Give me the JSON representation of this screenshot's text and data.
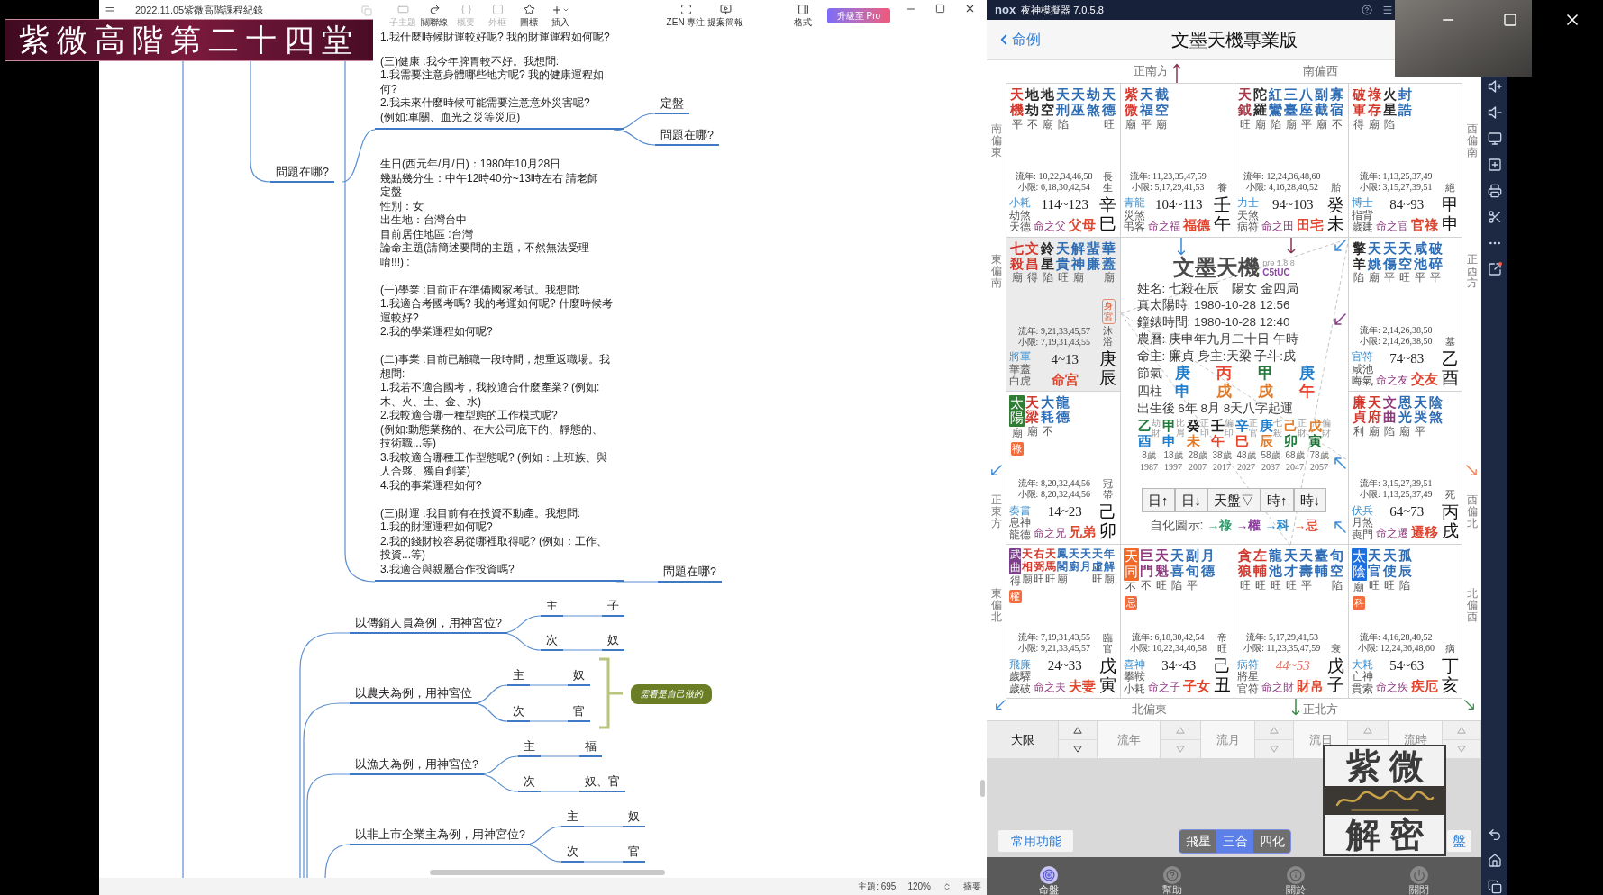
{
  "banner": "紫微高階第二十四堂",
  "mindmap": {
    "doc_title": "2022.11.05紫微高階課程紀錄",
    "toolbar": [
      {
        "label": "子主題",
        "disabled": true
      },
      {
        "label": "關聯線",
        "disabled": false
      },
      {
        "label": "概要",
        "disabled": true
      },
      {
        "label": "外框",
        "disabled": true
      },
      {
        "label": "圖標",
        "disabled": false
      },
      {
        "label": "插入",
        "disabled": false
      }
    ],
    "view_tools": [
      "ZEN 專注",
      "提案簡報",
      "格式"
    ],
    "upgrade": "升級至 Pro",
    "topic": "問題在哪?",
    "detail_blocks": [
      {
        "groups": [
          [
            "1.我什麼時候財運較好呢? 我的財運運程如何呢?"
          ],
          [
            "(三)健康 :我今年脾胃較不好。我想問:",
            "1.我需要注意身體哪些地方呢? 我的健康運程如何?",
            "2.我未來什麼時候可能需要注意意外災害呢? (例如:車關、血光之災等災厄)"
          ]
        ],
        "branches": [
          "定盤",
          "問題在哪?"
        ]
      },
      {
        "groups": [
          [
            "生日(西元年/月/日)：1980年10月28日",
            "幾點幾分生：中午12時40分~13時左右 請老師定盤",
            "性別：女",
            "出生地：台灣台中",
            "目前居住地區 :台灣",
            "論命主題(請簡述要問的主題，不然無法受理唷!!!) :"
          ],
          [
            "(一)學業 :目前正在準備國家考試。我想問:",
            "1.我適合考國考嗎? 我的考運如何呢? 什麼時候考運較好?",
            "2.我的學業運程如何呢?"
          ],
          [
            "(二)事業 :目前已離職一段時間，想重返職場。我想問:",
            "1.我若不適合國考，我較適合什麼產業? (例如:木、火、土、金、水)",
            "2.我較適合哪一種型態的工作模式呢?",
            "(例如:動態業務的、在大公司底下的、靜態的、技術職...等)",
            "3.我較適合哪種工作型態呢? (例如：上班族、與人合夥、獨自創業)",
            "4.我的事業運程如何?"
          ],
          [
            "(三)財運 :我目前有在投資不動產。我想問:",
            "1.我的財運運程如何呢?",
            "2.我的錢財較容易從哪裡取得呢? (例如：工作、投資...等)",
            "3.我適合與親屬合作投資嗎?"
          ]
        ],
        "branches": [
          "問題在哪?"
        ]
      }
    ],
    "examples": [
      {
        "title": "以傳銷人員為例，用神宮位?",
        "rows": [
          {
            "rank": "主",
            "palace": "子"
          },
          {
            "rank": "次",
            "palace": "奴"
          }
        ]
      },
      {
        "title": "以農夫為例，用神宮位",
        "rows": [
          {
            "rank": "主",
            "palace": "奴"
          },
          {
            "rank": "次",
            "palace": "官"
          }
        ],
        "note": "需看是自己做的"
      },
      {
        "title": "以漁夫為例，用神宮位?",
        "rows": [
          {
            "rank": "主",
            "palace": "福"
          },
          {
            "rank": "次",
            "palace": "奴、官"
          }
        ]
      },
      {
        "title": "以非上市企業主為例，用神宮位?",
        "rows": [
          {
            "rank": "主",
            "palace": "奴"
          },
          {
            "rank": "次",
            "palace": "官"
          }
        ]
      }
    ],
    "status": {
      "topics": "主題: 695",
      "zoom": "120%",
      "summary": "摘要"
    }
  },
  "emulator": {
    "logo": "nox",
    "title": "夜神模擬器 7.0.5.8"
  },
  "app": {
    "back": "命例",
    "title": "文墨天機專業版",
    "directions": {
      "top": [
        "正南方",
        "南偏西"
      ],
      "bottom": [
        "北偏東",
        "正北方"
      ],
      "left": [
        "南偏東",
        "東偏南",
        "正東方",
        "東偏北"
      ],
      "right": [
        "西偏南",
        "正西方",
        "西偏北",
        "北偏西"
      ]
    },
    "palaces": [
      {
        "stars": [
          {
            "name": "天機",
            "kind": "plain",
            "color": "#d23a2f",
            "brightness": "平"
          },
          {
            "name": "地劫",
            "kind": "plain",
            "color": "#2a2a2a",
            "brightness": "不"
          },
          {
            "name": "地空",
            "kind": "plain",
            "color": "#2a2a2a",
            "brightness": "廟"
          },
          {
            "name": "天刑",
            "kind": "plain",
            "color": "#2f6db5",
            "brightness": "陷"
          },
          {
            "name": "天巫",
            "kind": "plain",
            "color": "#2f6db5"
          },
          {
            "name": "劫煞",
            "kind": "plain",
            "color": "#2f6db5"
          },
          {
            "name": "天德",
            "kind": "plain",
            "color": "#2f6db5",
            "brightness": "旺"
          }
        ],
        "years": "流年: 10,22,34,46,58",
        "minor_limit": "小限: 6,18,30,42,54",
        "stage": "長生",
        "range": "114~123",
        "current": false,
        "spirits": [
          "小耗",
          "劫煞",
          "天德"
        ],
        "owner": "命之父",
        "name": "父母",
        "stem_branch": "辛巳",
        "selected": false
      },
      {
        "stars": [
          {
            "name": "紫微",
            "kind": "plain",
            "color": "#d23a2f",
            "brightness": "廟"
          },
          {
            "name": "天福",
            "kind": "plain",
            "color": "#2f6db5",
            "brightness": "平"
          },
          {
            "name": "截空",
            "kind": "plain",
            "color": "#2f6db5",
            "brightness": "廟"
          }
        ],
        "years": "流年: 11,23,35,47,59",
        "minor_limit": "小限: 5,17,29,41,53",
        "stage": "養",
        "range": "104~113",
        "current": false,
        "spirits": [
          "青龍",
          "災煞",
          "弔客"
        ],
        "owner": "命之福",
        "name": "福德",
        "stem_branch": "壬午",
        "selected": false
      },
      {
        "stars": [
          {
            "name": "天鉞",
            "kind": "plain",
            "color": "#a83a4a",
            "brightness": "旺"
          },
          {
            "name": "陀羅",
            "kind": "plain",
            "color": "#2a2a2a",
            "brightness": "廟"
          },
          {
            "name": "紅鸞",
            "kind": "plain",
            "color": "#2f6db5",
            "brightness": "陷"
          },
          {
            "name": "三臺",
            "kind": "plain",
            "color": "#2f6db5",
            "brightness": "廟"
          },
          {
            "name": "八座",
            "kind": "plain",
            "color": "#2f6db5",
            "brightness": "平"
          },
          {
            "name": "副截",
            "kind": "plain",
            "color": "#2f6db5",
            "brightness": "廟"
          },
          {
            "name": "寡宿",
            "kind": "plain",
            "color": "#2f6db5",
            "brightness": "不"
          }
        ],
        "years": "流年: 12,24,36,48,60",
        "minor_limit": "小限: 4,16,28,40,52",
        "stage": "胎",
        "range": "94~103",
        "current": false,
        "spirits": [
          "力士",
          "天煞",
          "病符"
        ],
        "owner": "命之田",
        "name": "田宅",
        "stem_branch": "癸未",
        "selected": false
      },
      {
        "stars": [
          {
            "name": "破軍",
            "kind": "plain",
            "color": "#d23a2f",
            "brightness": "得"
          },
          {
            "name": "祿存",
            "kind": "plain",
            "color": "#d23a2f",
            "brightness": "廟"
          },
          {
            "name": "火星",
            "kind": "plain",
            "color": "#2a2a2a",
            "brightness": "陷"
          },
          {
            "name": "封誥",
            "kind": "plain",
            "color": "#2f6db5"
          }
        ],
        "years": "流年: 1,13,25,37,49",
        "minor_limit": "小限: 3,15,27,39,51",
        "stage": "絕",
        "range": "84~93",
        "current": false,
        "spirits": [
          "博士",
          "指背",
          "歲建"
        ],
        "owner": "命之官",
        "name": "官祿",
        "stem_branch": "甲申",
        "selected": false
      },
      {
        "stars": [
          {
            "name": "七殺",
            "kind": "plain",
            "color": "#d23a2f",
            "brightness": "廟"
          },
          {
            "name": "文昌",
            "kind": "plain",
            "color": "#d23a2f",
            "brightness": "得"
          },
          {
            "name": "鈴星",
            "kind": "plain",
            "color": "#2a2a2a",
            "brightness": "陷"
          },
          {
            "name": "天貴",
            "kind": "plain",
            "color": "#2f6db5",
            "brightness": "旺"
          },
          {
            "name": "解神",
            "kind": "plain",
            "color": "#2f6db5",
            "brightness": "廟"
          },
          {
            "name": "蜚廉",
            "kind": "plain",
            "color": "#2f6db5"
          },
          {
            "name": "華蓋",
            "kind": "plain",
            "color": "#2f6db5",
            "brightness": "廟"
          }
        ],
        "tag": "身宮",
        "years": "流年: 9,21,33,45,57",
        "minor_limit": "小限: 7,19,31,43,55",
        "stage": "沐浴",
        "range": "4~13",
        "current": false,
        "spirits": [
          "將軍",
          "華蓋",
          "白虎"
        ],
        "name": "命宮",
        "stem_branch": "庚辰",
        "selected": true
      },
      {
        "stars": [
          {
            "name": "擎羊",
            "kind": "plain",
            "color": "#2a2a2a",
            "brightness": "陷"
          },
          {
            "name": "天姚",
            "kind": "plain",
            "color": "#2f6db5",
            "brightness": "廟"
          },
          {
            "name": "天傷",
            "kind": "plain",
            "color": "#2f6db5",
            "brightness": "平"
          },
          {
            "name": "天空",
            "kind": "plain",
            "color": "#2f6db5",
            "brightness": "旺"
          },
          {
            "name": "咸池",
            "kind": "plain",
            "color": "#2f6db5",
            "brightness": "平"
          },
          {
            "name": "破碎",
            "kind": "plain",
            "color": "#2f6db5",
            "brightness": "平"
          }
        ],
        "years": "流年: 2,14,26,38,50",
        "minor_limit": "小限: 2,14,26,38,50",
        "stage": "墓",
        "range": "74~83",
        "current": false,
        "spirits": [
          "官符",
          "咸池",
          "晦氣"
        ],
        "owner": "命之友",
        "name": "交友",
        "stem_branch": "乙酉",
        "selected": false
      },
      {
        "stars": [
          {
            "name": "太陽",
            "kind": "tile",
            "color": "#2e7d32",
            "brightness": "廟",
            "sihua": "祿"
          },
          {
            "name": "天梁",
            "kind": "plain",
            "color": "#d23a2f",
            "brightness": "廟"
          },
          {
            "name": "大耗",
            "kind": "plain",
            "color": "#2f6db5",
            "brightness": "不"
          },
          {
            "name": "龍德",
            "kind": "plain",
            "color": "#2f6db5"
          }
        ],
        "years": "流年: 8,20,32,44,56",
        "minor_limit": "小限: 8,20,32,44,56",
        "stage": "冠帶",
        "range": "14~23",
        "current": false,
        "spirits": [
          "奏書",
          "息神",
          "龍德"
        ],
        "owner": "命之兄",
        "name": "兄弟",
        "stem_branch": "己卯",
        "selected": false
      },
      {
        "stars": [
          {
            "name": "廉貞",
            "kind": "plain",
            "color": "#d23a2f",
            "brightness": "利"
          },
          {
            "name": "天府",
            "kind": "plain",
            "color": "#d23a2f",
            "brightness": "廟"
          },
          {
            "name": "文曲",
            "kind": "plain",
            "color": "#8e3a7e",
            "brightness": "陷"
          },
          {
            "name": "恩光",
            "kind": "plain",
            "color": "#2f6db5",
            "brightness": "廟"
          },
          {
            "name": "天哭",
            "kind": "plain",
            "color": "#2f6db5",
            "brightness": "平"
          },
          {
            "name": "陰煞",
            "kind": "plain",
            "color": "#2f6db5"
          }
        ],
        "years": "流年: 3,15,27,39,51",
        "minor_limit": "小限: 1,13,25,37,49",
        "stage": "死",
        "range": "64~73",
        "current": false,
        "spirits": [
          "伏兵",
          "月煞",
          "喪門"
        ],
        "owner": "命之遷",
        "name": "遷移",
        "stem_branch": "丙戌",
        "selected": false
      },
      {
        "stars": [
          {
            "name": "武曲",
            "kind": "tile",
            "color": "#7b3f8c",
            "brightness": "得",
            "sihua": "權"
          },
          {
            "name": "天相",
            "kind": "plain",
            "color": "#d23a2f",
            "brightness": "廟"
          },
          {
            "name": "右弼",
            "kind": "plain",
            "color": "#d23a2f",
            "brightness": "旺"
          },
          {
            "name": "天馬",
            "kind": "plain",
            "color": "#d23a2f",
            "brightness": "旺"
          },
          {
            "name": "鳳閣",
            "kind": "plain",
            "color": "#2f6db5",
            "brightness": "廟"
          },
          {
            "name": "天廚",
            "kind": "plain",
            "color": "#2f6db5"
          },
          {
            "name": "天月",
            "kind": "plain",
            "color": "#2f6db5"
          },
          {
            "name": "天虛",
            "kind": "plain",
            "color": "#2f6db5",
            "brightness": "旺"
          },
          {
            "name": "年解",
            "kind": "plain",
            "color": "#2f6db5",
            "brightness": "廟"
          }
        ],
        "years": "流年: 7,19,31,43,55",
        "minor_limit": "小限: 9,21,33,45,57",
        "stage": "臨官",
        "range": "24~33",
        "current": false,
        "spirits": [
          "飛廉",
          "歲驛",
          "歲破"
        ],
        "owner": "命之夫",
        "name": "夫妻",
        "stem_branch": "戊寅",
        "selected": false
      },
      {
        "stars": [
          {
            "name": "天同",
            "kind": "tile",
            "color": "#f26a2a",
            "brightness": "不",
            "sihua": "忌"
          },
          {
            "name": "巨門",
            "kind": "plain",
            "color": "#8e3a7e",
            "brightness": "不"
          },
          {
            "name": "天魁",
            "kind": "plain",
            "color": "#8e3a7e",
            "brightness": "旺"
          },
          {
            "name": "天喜",
            "kind": "plain",
            "color": "#2f6db5",
            "brightness": "陷"
          },
          {
            "name": "副旬",
            "kind": "plain",
            "color": "#2f6db5",
            "brightness": "平"
          },
          {
            "name": "月德",
            "kind": "plain",
            "color": "#2f6db5"
          }
        ],
        "years": "流年: 6,18,30,42,54",
        "minor_limit": "小限: 10,22,34,46,58",
        "stage": "帝旺",
        "range": "34~43",
        "current": false,
        "spirits": [
          "喜神",
          "攀鞍",
          "小耗"
        ],
        "owner": "命之子",
        "name": "子女",
        "stem_branch": "己丑",
        "selected": false
      },
      {
        "stars": [
          {
            "name": "貪狼",
            "kind": "plain",
            "color": "#d23a2f",
            "brightness": "旺"
          },
          {
            "name": "左輔",
            "kind": "plain",
            "color": "#d23a2f",
            "brightness": "旺"
          },
          {
            "name": "龍池",
            "kind": "plain",
            "color": "#2f6db5",
            "brightness": "旺"
          },
          {
            "name": "天才",
            "kind": "plain",
            "color": "#2f6db5",
            "brightness": "旺"
          },
          {
            "name": "天壽",
            "kind": "plain",
            "color": "#2f6db5",
            "brightness": "平"
          },
          {
            "name": "臺輔",
            "kind": "plain",
            "color": "#2f6db5"
          },
          {
            "name": "旬空",
            "kind": "plain",
            "color": "#2f6db5",
            "brightness": "陷"
          }
        ],
        "years": "流年: 5,17,29,41,53",
        "minor_limit": "小限: 11,23,35,47,59",
        "stage": "衰",
        "range": "44~53",
        "current": true,
        "spirits": [
          "病符",
          "將星",
          "官符"
        ],
        "owner": "命之財",
        "name": "財帛",
        "stem_branch": "戊子",
        "selected": false
      },
      {
        "stars": [
          {
            "name": "太陰",
            "kind": "tile",
            "color": "#1e6fe0",
            "brightness": "廟",
            "sihua": "科"
          },
          {
            "name": "天官",
            "kind": "plain",
            "color": "#2f6db5",
            "brightness": "旺"
          },
          {
            "name": "天使",
            "kind": "plain",
            "color": "#2f6db5",
            "brightness": "旺"
          },
          {
            "name": "孤辰",
            "kind": "plain",
            "color": "#2f6db5",
            "brightness": "陷"
          }
        ],
        "years": "流年: 4,16,28,40,52",
        "minor_limit": "小限: 12,24,36,48,60",
        "stage": "病",
        "range": "54~63",
        "current": false,
        "spirits": [
          "大耗",
          "亡神",
          "貫索"
        ],
        "owner": "命之疾",
        "name": "疾厄",
        "stem_branch": "丁亥",
        "selected": false
      }
    ],
    "center": {
      "brand": "文墨天機",
      "version": "pro 1.8.8",
      "code": "C5tUC",
      "lines": [
        "姓名: 七殺在辰　陽女 金四局",
        "真太陽時: 1980-10-28 12:56",
        "鐘錶時間: 1980-10-28 12:40",
        "農曆: 庚申年九月二十日 午時",
        "命主: 廉貞 身主:天梁 子斗:戌"
      ],
      "pillar_labels": [
        "節氣",
        "四柱"
      ],
      "pillars": [
        {
          "stem": {
            "text": "庚",
            "color": "#1e7fd0"
          },
          "branch": {
            "text": "申",
            "color": "#1e7fd0"
          }
        },
        {
          "stem": {
            "text": "丙",
            "color": "#e8452c"
          },
          "branch": {
            "text": "戌",
            "color": "#e07b2a"
          }
        },
        {
          "stem": {
            "text": "甲",
            "color": "#1f7a3a"
          },
          "branch": {
            "text": "戌",
            "color": "#e07b2a"
          }
        },
        {
          "stem": {
            "text": "庚",
            "color": "#1e7fd0"
          },
          "branch": {
            "text": "午",
            "color": "#e8452c"
          }
        }
      ],
      "luck_start": "出生後 6年 8月 8天八字起運",
      "decades": [
        {
          "stem": {
            "text": "乙",
            "color": "#1f7a3a"
          },
          "branch": {
            "text": "酉",
            "color": "#1e7fd0"
          },
          "god": "劫財",
          "age": "8歲",
          "year": "1987"
        },
        {
          "stem": {
            "text": "甲",
            "color": "#1f7a3a"
          },
          "branch": {
            "text": "申",
            "color": "#1e7fd0"
          },
          "god": "比肩",
          "age": "18歲",
          "year": "1997"
        },
        {
          "stem": {
            "text": "癸",
            "color": "#222222"
          },
          "branch": {
            "text": "未",
            "color": "#e07b2a"
          },
          "god": "正印",
          "age": "28歲",
          "year": "2007"
        },
        {
          "stem": {
            "text": "壬",
            "color": "#222222"
          },
          "branch": {
            "text": "午",
            "color": "#e8452c"
          },
          "god": "偏印",
          "age": "38歲",
          "year": "2017"
        },
        {
          "stem": {
            "text": "辛",
            "color": "#1e7fd0"
          },
          "branch": {
            "text": "巳",
            "color": "#e8452c"
          },
          "god": "正官",
          "age": "48歲",
          "year": "2027"
        },
        {
          "stem": {
            "text": "庚",
            "color": "#1e7fd0"
          },
          "branch": {
            "text": "辰",
            "color": "#e07b2a"
          },
          "god": "七殺",
          "age": "58歲",
          "year": "2037"
        },
        {
          "stem": {
            "text": "己",
            "color": "#e07b2a"
          },
          "branch": {
            "text": "卯",
            "color": "#1f7a3a"
          },
          "god": "正財",
          "age": "68歲",
          "year": "2047"
        },
        {
          "stem": {
            "text": "戊",
            "color": "#e07b2a"
          },
          "branch": {
            "text": "寅",
            "color": "#1f7a3a"
          },
          "god": "偏財",
          "age": "78歲",
          "year": "2057"
        }
      ],
      "buttons": [
        "日↑",
        "日↓",
        "天盤▽",
        "時↑",
        "時↓"
      ],
      "legend_label": "自化圖示:",
      "legend": [
        {
          "text": "→祿",
          "color": "#2e9a6a"
        },
        {
          "text": "→權",
          "color": "#8e3aa0"
        },
        {
          "text": "→科",
          "color": "#2a8ad0"
        },
        {
          "text": "→忌",
          "color": "#e8553a"
        }
      ]
    },
    "periods": [
      {
        "label": "大限",
        "selected": true
      },
      {
        "label": "流年",
        "selected": false
      },
      {
        "label": "流月",
        "selected": false
      },
      {
        "label": "流日",
        "selected": false
      },
      {
        "label": "流時",
        "selected": false
      }
    ],
    "common": "常用功能",
    "modes": [
      {
        "label": "飛星",
        "selected": false
      },
      {
        "label": "三合",
        "selected": true
      },
      {
        "label": "四化",
        "selected": false
      }
    ],
    "chart_button": "盤",
    "nav": [
      {
        "label": "命盤",
        "selected": true
      },
      {
        "label": "幫助",
        "selected": false
      },
      {
        "label": "關於",
        "selected": false
      },
      {
        "label": "關閉",
        "selected": false
      }
    ]
  },
  "overlay_logo": {
    "top": "紫微",
    "bottom": "解密"
  }
}
